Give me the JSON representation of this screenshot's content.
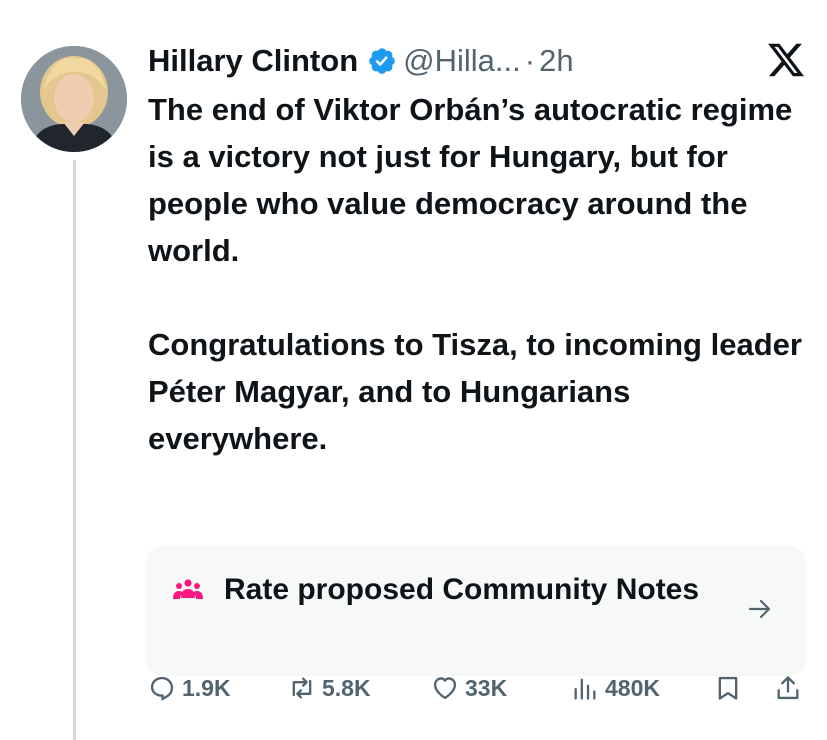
{
  "tweet": {
    "author_name": "Hillary Clinton",
    "handle": "@Hilla...",
    "separator": "·",
    "time": "2h",
    "paragraphs": [
      "The end of Viktor Orbán’s autocratic regime is a victory not just for Hungary, but for people who value democracy around the world.",
      "Congratulations to Tisza, to incoming leader Péter Magyar, and to Hungarians everywhere."
    ]
  },
  "community_notes": {
    "label": "Rate proposed Community Notes",
    "icon": "community-notes-icon"
  },
  "actions": {
    "replies": "1.9K",
    "reposts": "5.8K",
    "likes": "33K",
    "views": "480K"
  },
  "colors": {
    "text": "#0f1419",
    "secondary": "#536471",
    "verified": "#1d9bf0",
    "community_notes_icon": "#f91880",
    "card_bg": "#f7f9f9"
  }
}
